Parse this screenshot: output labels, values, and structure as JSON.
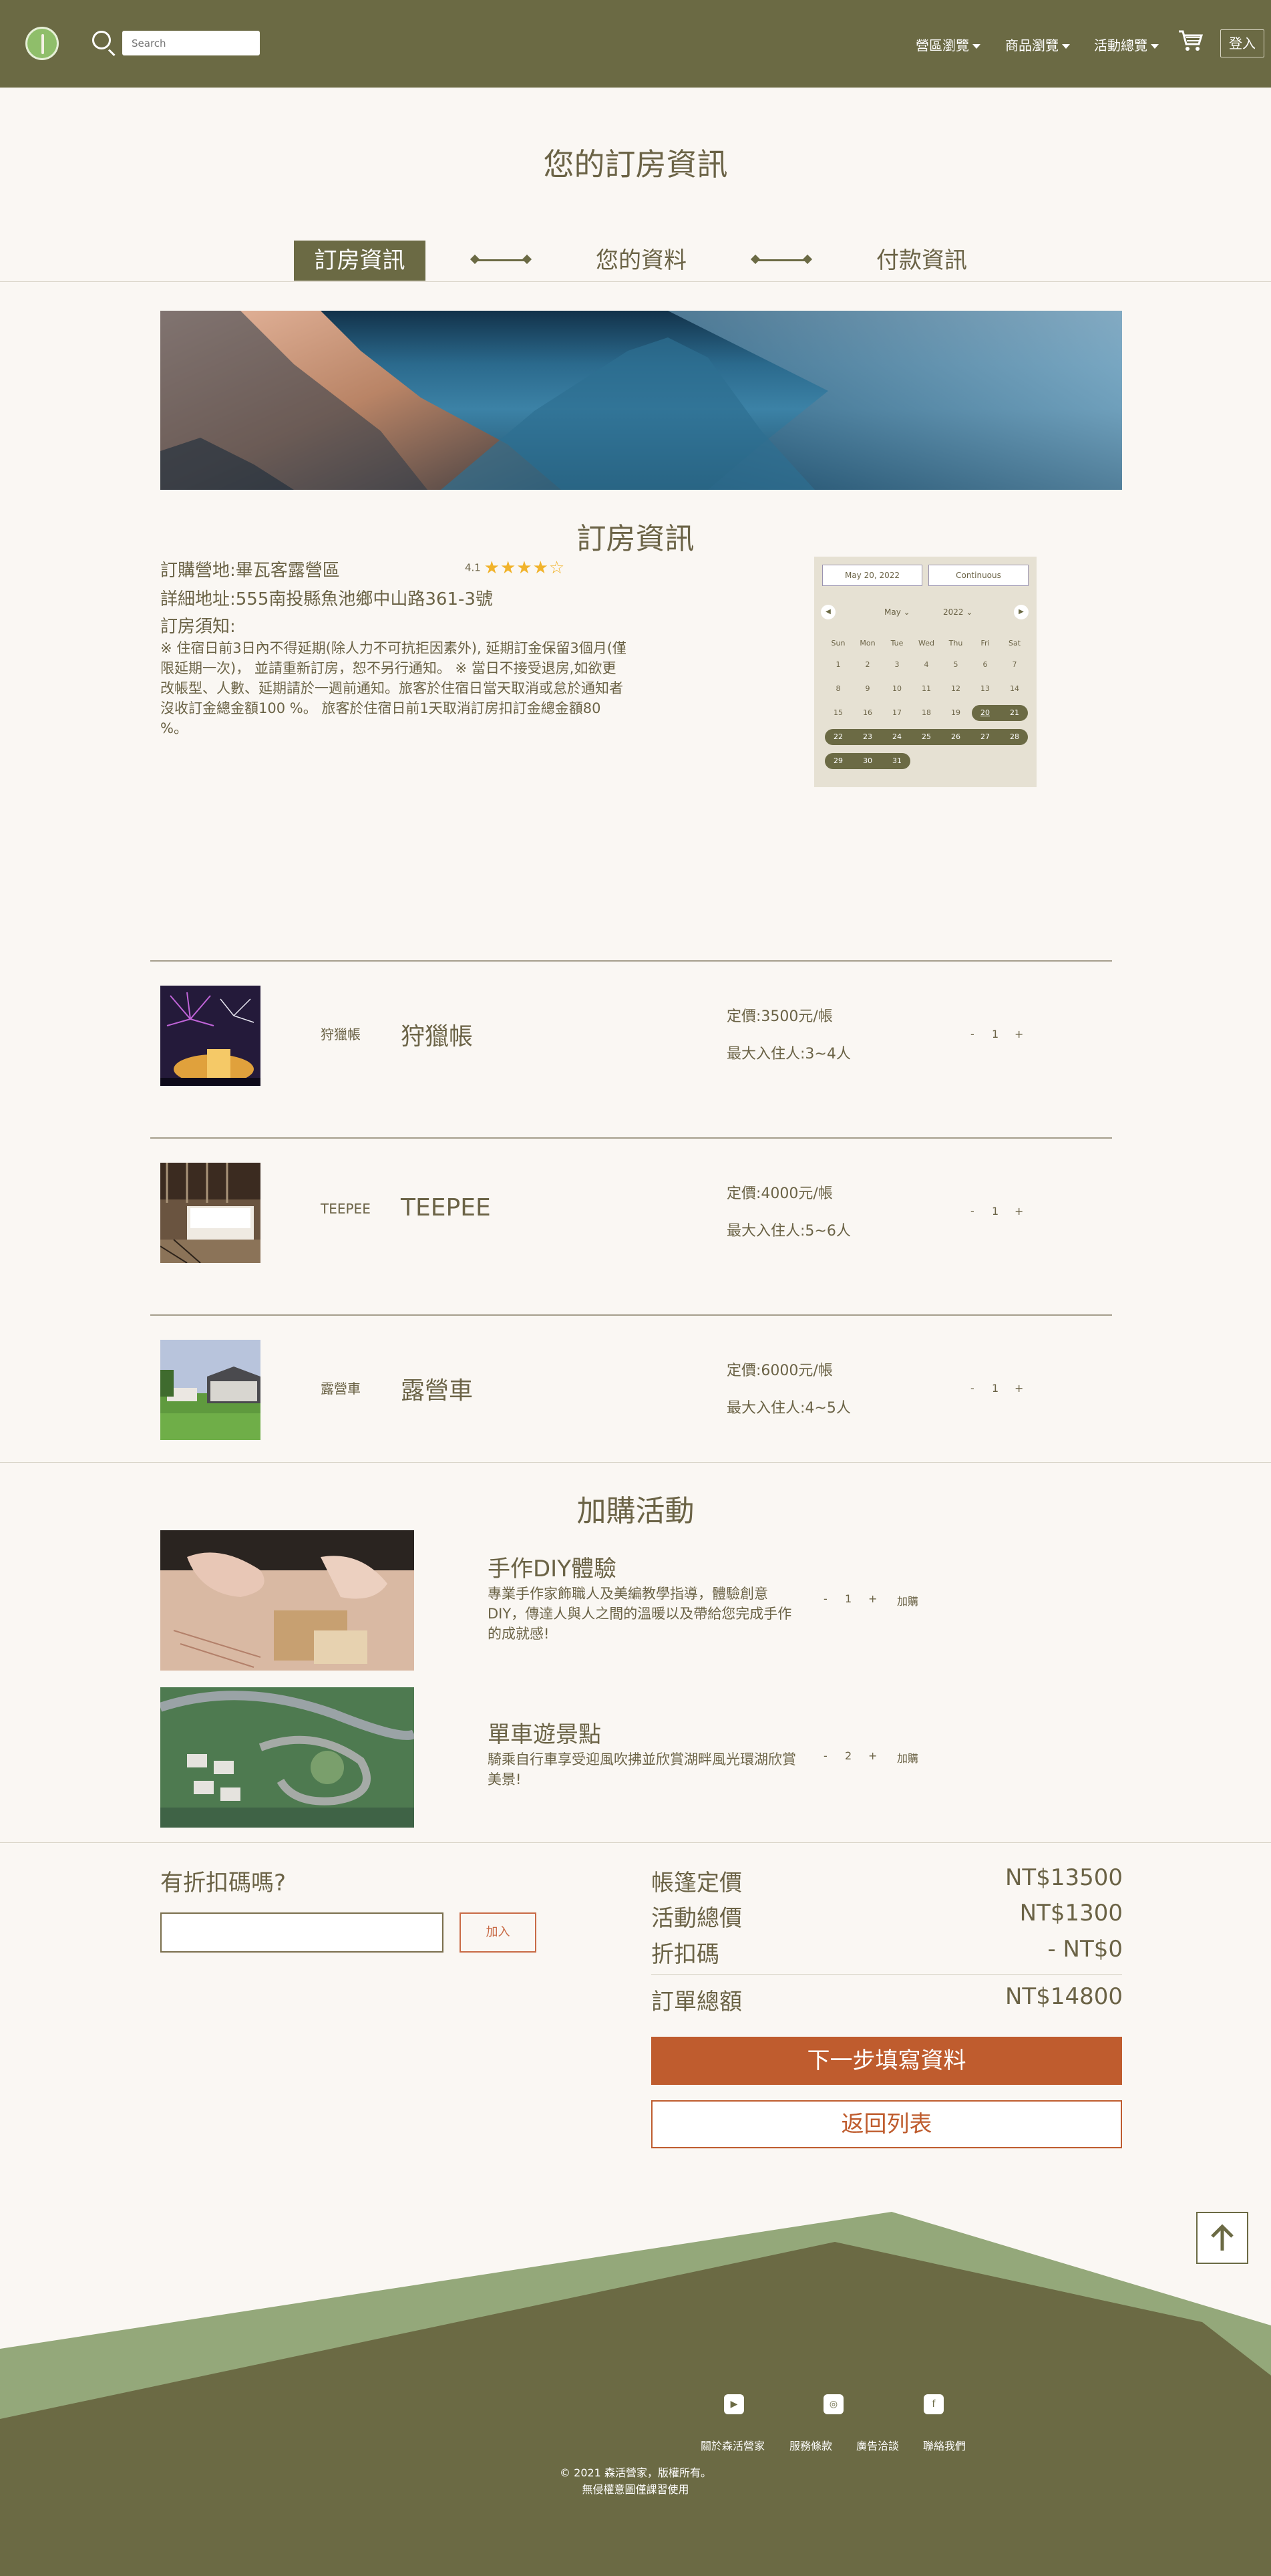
{
  "nav": {
    "search_placeholder": "Search",
    "links": [
      "營區瀏覽",
      "商品瀏覽",
      "活動總覽"
    ],
    "login": "登入"
  },
  "page_title": "您的訂房資訊",
  "steps": [
    "訂房資訊",
    "您的資料",
    "付款資訊"
  ],
  "booking": {
    "title": "訂房資訊",
    "campsite": "訂購營地:畢瓦客露營區",
    "rating": "4.1",
    "stars": "★★★★☆",
    "address": "詳細地址:555南投縣魚池鄉中山路361-3號",
    "notice_label": "訂房須知:",
    "notice": "※ 住宿日前3日內不得延期(除人力不可抗拒因素外), 延期訂金保留3個月(僅限延期一次)， 並請重新訂房，恕不另行通知。 ※ 當日不接受退房,如欲更改帳型、人數、延期請於一週前通知。旅客於住宿日當天取消或怠於通知者沒收訂金總金額100 %。 旅客於住宿日前1天取消訂房扣訂金總金額80 %。"
  },
  "calendar": {
    "start_date": "May 20, 2022",
    "end_date": "Continuous",
    "month": "May",
    "year": "2022",
    "weekdays": [
      "Sun",
      "Mon",
      "Tue",
      "Wed",
      "Thu",
      "Fri",
      "Sat"
    ],
    "days": [
      1,
      2,
      3,
      4,
      5,
      6,
      7,
      8,
      9,
      10,
      11,
      12,
      13,
      14,
      15,
      16,
      17,
      18,
      19,
      20,
      21,
      22,
      23,
      24,
      25,
      26,
      27,
      28,
      29,
      30,
      31
    ],
    "selected_from": 20,
    "selected_to": 31
  },
  "rooms": [
    {
      "small": "狩獵帳",
      "name": "狩獵帳",
      "price": "定價:3500元/帳",
      "capacity": "最大入住人:3~4人",
      "qty": "1"
    },
    {
      "small": "TEEPEE",
      "name": "TEEPEE",
      "price": "定價:4000元/帳",
      "capacity": "最大入住人:5~6人",
      "qty": "1"
    },
    {
      "small": "露營車",
      "name": "露營車",
      "price": "定價:6000元/帳",
      "capacity": "最大入住人:4~5人",
      "qty": "1"
    }
  ],
  "qty_minus": "-",
  "qty_plus": "+",
  "addons_title": "加購活動",
  "addons": [
    {
      "title": "手作DIY體驗",
      "desc": "專業手作家飾職人及美編教學指導，體驗創意DIY，傳達人與人之間的溫暖以及帶給您完成手作的成就感!",
      "qty": "1",
      "add": "加購"
    },
    {
      "title": "單車遊景點",
      "desc": "騎乘自行車享受迎風吹拂並欣賞湖畔風光環湖欣賞美景!",
      "qty": "2",
      "add": "加購"
    }
  ],
  "discount": {
    "question": "有折扣碼嗎?",
    "button": "加入"
  },
  "summary": {
    "tent_label": "帳篷定價",
    "tent_value": "NT$13500",
    "activity_label": "活動總價",
    "activity_value": "NT$1300",
    "code_label": "折扣碼",
    "code_value": "- NT$0",
    "total_label": "訂單總額",
    "total_value": "NT$14800"
  },
  "buttons": {
    "next": "下一步填寫資料",
    "back": "返回列表"
  },
  "footer": {
    "links": [
      "關於森活營家",
      "服務條款",
      "廣告洽談",
      "聯絡我們"
    ],
    "copy1": "© 2021 森活營家，版權所有。",
    "copy2": "無侵權意圖僅課習使用"
  },
  "colors": {
    "olive": "#6b6a44",
    "accent": "#bf5c2e",
    "green": "#94a87a"
  }
}
